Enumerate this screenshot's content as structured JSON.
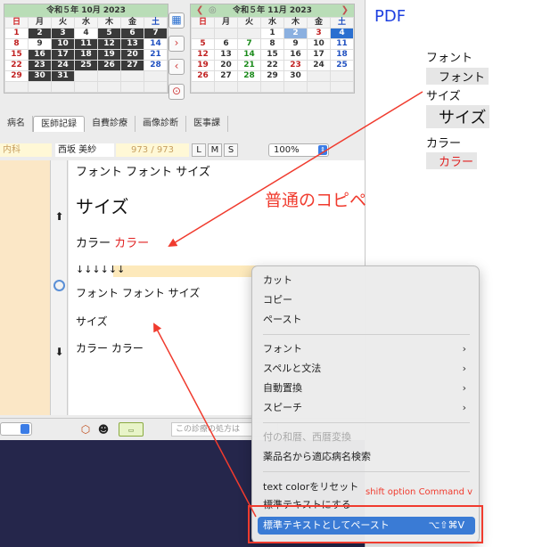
{
  "calendar_oct": {
    "title": "令和５年 10月 2023",
    "dows": [
      "日",
      "月",
      "火",
      "水",
      "木",
      "金",
      "土"
    ],
    "weeks": [
      [
        "1",
        "2",
        "3",
        "4",
        "5",
        "6",
        "7"
      ],
      [
        "8",
        "9",
        "10",
        "11",
        "12",
        "13",
        "14"
      ],
      [
        "15",
        "16",
        "17",
        "18",
        "19",
        "20",
        "21"
      ],
      [
        "22",
        "23",
        "24",
        "25",
        "26",
        "27",
        "28"
      ],
      [
        "29",
        "30",
        "31",
        "",
        "",
        "",
        ""
      ],
      [
        "",
        "",
        "",
        "",
        "",
        "",
        ""
      ]
    ]
  },
  "calendar_nov": {
    "title": "令和５年 11月 2023",
    "dows": [
      "日",
      "月",
      "火",
      "水",
      "木",
      "金",
      "土"
    ],
    "weeks": [
      [
        "",
        "",
        "",
        "1",
        "2",
        "3",
        "4"
      ],
      [
        "5",
        "6",
        "7",
        "8",
        "9",
        "10",
        "11"
      ],
      [
        "12",
        "13",
        "14",
        "15",
        "16",
        "17",
        "18"
      ],
      [
        "19",
        "20",
        "21",
        "22",
        "23",
        "24",
        "25"
      ],
      [
        "26",
        "27",
        "28",
        "29",
        "30",
        "",
        ""
      ],
      [
        "",
        "",
        "",
        "",
        "",
        "",
        ""
      ]
    ]
  },
  "tabs": [
    "病名",
    "医師記録",
    "自費診療",
    "画像診断",
    "医事課"
  ],
  "info": {
    "dept": "内科",
    "patient": "西坂 美紗",
    "count": "973 / 973",
    "sizes": [
      "L",
      "M",
      "S"
    ],
    "zoom": "100%"
  },
  "editor_lines": {
    "line1": "フォント フォント サイズ",
    "line2": "サイズ",
    "line3a": "カラー ",
    "line3b": "カラー",
    "line4": "↓↓↓↓↓↓",
    "line5": "フォント フォント サイズ",
    "line6": "サイズ",
    "line7": "カラー カラー"
  },
  "bottom": {
    "search_placeholder": "この診療の処方は"
  },
  "pdf": {
    "label": "PDF",
    "t1": "フォント",
    "t2": "フォント",
    "t3": "サイズ",
    "t4": "サイズ",
    "t5": "カラー",
    "t6": "カラー"
  },
  "annotations": {
    "normal_copy": "普通のコピペ",
    "shortcut": "shift option Command v"
  },
  "context_menu": {
    "cut": "カット",
    "copy": "コピー",
    "paste": "ペースト",
    "font": "フォント",
    "spelling": "スペルと文法",
    "substitutions": "自動置換",
    "speech": "スピーチ",
    "date_convert": "付の和暦、西暦変換",
    "drug_search": "薬品名から適応病名検索",
    "reset_color": "text colorをリセット",
    "make_standard": "標準テキストにする",
    "paste_standard": "標準テキストとしてペースト",
    "paste_standard_shortcut": "⌥⇧⌘V"
  },
  "colors": {
    "accent": "#3a7bd5",
    "annotation_red": "#f03b2e",
    "pdf_blue": "#1d3fe0"
  }
}
